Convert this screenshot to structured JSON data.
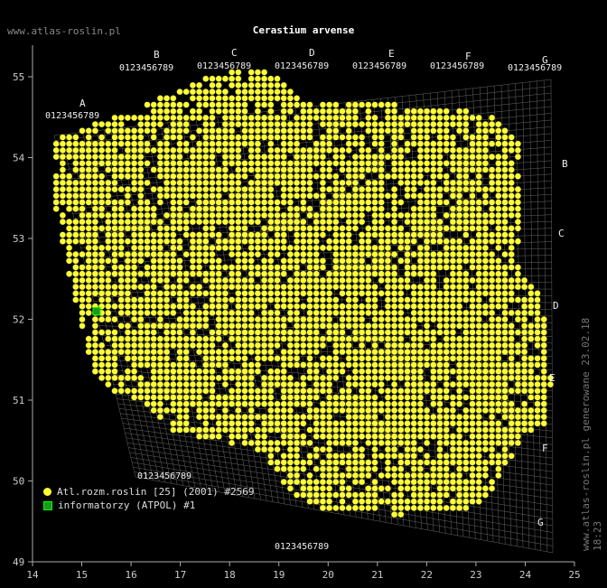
{
  "header": {
    "site": "www.atlas-roslin.pl",
    "title": "Cerastium arvense",
    "vertical_note": "www.atlas-roslin.pl generowane 23.02.18 18:23"
  },
  "legend": {
    "series1": "Atl.rozm.roslin [25] (2001) #2569",
    "series2": "informatorzy (ATPOL) #1"
  },
  "axes": {
    "x_ticks": [
      "14",
      "15",
      "16",
      "17",
      "18",
      "19",
      "20",
      "21",
      "22",
      "23",
      "24",
      "25"
    ],
    "y_ticks": [
      "55",
      "54",
      "53",
      "52",
      "51",
      "50",
      "49"
    ]
  },
  "grid": {
    "top_letters": [
      "A",
      "B",
      "C",
      "D",
      "E",
      "F",
      "G"
    ],
    "right_letters": [
      "B",
      "C",
      "D",
      "E",
      "F",
      "G"
    ],
    "digits": "0123456789"
  },
  "colors": {
    "occurrence": "#ffff33",
    "informant": "#1a9a1a",
    "grid": "#777777",
    "background": "#000000"
  },
  "chart_data": {
    "type": "scatter",
    "title": "Cerastium arvense",
    "xlim": [
      14,
      25
    ],
    "ylim": [
      49,
      55.5
    ],
    "series": [
      {
        "name": "Atl.rozm.roslin [25] (2001) #2569",
        "count": 2569
      },
      {
        "name": "informatorzy (ATPOL) #1",
        "count": 1,
        "points": [
          [
            15.3,
            52.1
          ]
        ]
      }
    ]
  }
}
